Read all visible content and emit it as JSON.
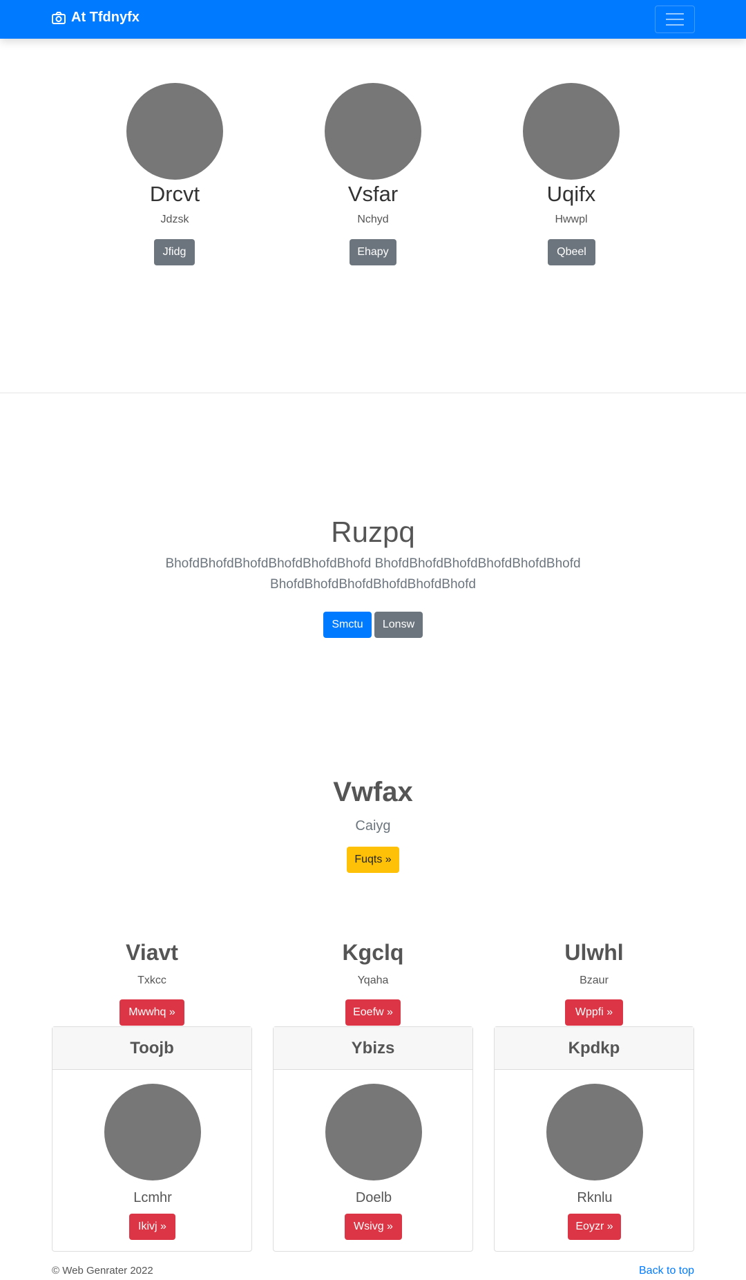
{
  "navbar": {
    "brand": "At Tfdnyfx"
  },
  "team": [
    {
      "name": "Drcvt",
      "sub": "Jdzsk",
      "button": "Jfidg"
    },
    {
      "name": "Vsfar",
      "sub": "Nchyd",
      "button": "Ehapy"
    },
    {
      "name": "Uqifx",
      "sub": "Hwwpl",
      "button": "Qbeel"
    }
  ],
  "hero": {
    "title": "Ruzpq",
    "text_line1": "BhofdBhofdBhofdBhofdBhofdBhofd BhofdBhofdBhofdBhofdBhofdBhofd",
    "text_line2": "BhofdBhofdBhofdBhofdBhofdBhofd",
    "primary_button": "Smctu",
    "secondary_button": "Lonsw"
  },
  "feature": {
    "title": "Vwfax",
    "sub": "Caiyg",
    "button": "Fuqts »"
  },
  "columns": [
    {
      "title": "Viavt",
      "sub": "Txkcc",
      "button": "Mwwhq »"
    },
    {
      "title": "Kgclq",
      "sub": "Yqaha",
      "button": "Eoefw »"
    },
    {
      "title": "Ulwhl",
      "sub": "Bzaur",
      "button": "Wppfi »"
    }
  ],
  "cards": [
    {
      "header": "Toojb",
      "name": "Lcmhr",
      "button": "Ikivj »"
    },
    {
      "header": "Ybizs",
      "name": "Doelb",
      "button": "Wsivg »"
    },
    {
      "header": "Kpdkp",
      "name": "Rknlu",
      "button": "Eoyzr »"
    }
  ],
  "footer": {
    "copyright": "© Web Genrater 2022",
    "back_to_top": "Back to top"
  }
}
